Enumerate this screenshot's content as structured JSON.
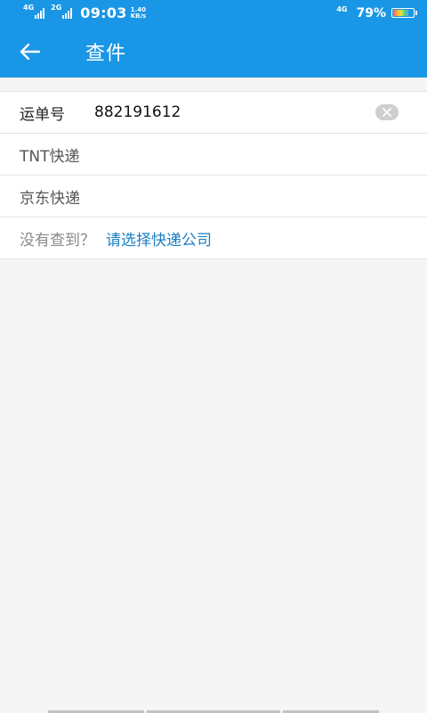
{
  "status_bar": {
    "net_left_1": "4G",
    "net_left_2": "2G",
    "time": "09:03",
    "speed_value": "1.40",
    "speed_unit": "KB/s",
    "net_right": "4G",
    "battery": "79%",
    "battery_level": 79
  },
  "app_bar": {
    "title": "查件",
    "back_icon": "arrow-left-icon"
  },
  "waybill": {
    "label": "运单号",
    "value": "882191612",
    "clear_icon": "clear-x-icon"
  },
  "companies": [
    {
      "name": "TNT快递"
    },
    {
      "name": "京东快递"
    }
  ],
  "not_found": {
    "prompt": "没有查到？",
    "link": "请选择快递公司"
  },
  "colors": {
    "primary": "#1a96e6",
    "link": "#1a7fc4",
    "background": "#f5f5f5"
  }
}
